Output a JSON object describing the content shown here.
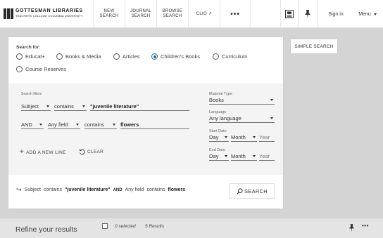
{
  "header": {
    "logo_line1": "GOTTESMAN LIBRARIES",
    "logo_line2": "TEACHERS COLLEGE COLUMBIA UNIVERSITY",
    "nav": [
      {
        "label": "NEW\nSEARCH"
      },
      {
        "label": "JOURNAL\nSEARCH"
      },
      {
        "label": "BROWSE\nSEARCH"
      },
      {
        "label": "CLIO ↗"
      }
    ],
    "more_label": "•••",
    "sign_in": "Sign in",
    "menu": "Menu"
  },
  "search": {
    "for_label": "Search for:",
    "options": [
      {
        "label": "Educat+",
        "selected": false
      },
      {
        "label": "Books & Media",
        "selected": false
      },
      {
        "label": "Articles",
        "selected": false
      },
      {
        "label": "Children's Books",
        "selected": true
      },
      {
        "label": "Curriculum",
        "selected": false
      },
      {
        "label": "Course Reserves",
        "selected": false
      }
    ],
    "filters_label": "Search filters",
    "row1": {
      "field": "Subject",
      "operator": "contains",
      "value": "\"juvenile literature\""
    },
    "row2": {
      "boolean": "AND",
      "field": "Any field",
      "operator": "contains",
      "value": "flowers"
    },
    "add_line": "ADD A NEW LINE",
    "clear": "CLEAR",
    "material_type": {
      "label": "Material Type",
      "value": "Books"
    },
    "language": {
      "label": "Language",
      "value": "Any language"
    },
    "start_date": {
      "label": "Start Date",
      "day": "Day",
      "month": "Month",
      "year": "Year"
    },
    "end_date": {
      "label": "End Date",
      "day": "Day",
      "month": "Month",
      "year": "Year"
    },
    "summary": {
      "field1": "Subject",
      "op1": "contains",
      "val1": "\"juvenile literature\"",
      "bool": "AND",
      "field2": "Any field",
      "op2": "contains",
      "val2": "flowers"
    },
    "search_button": "SEARCH",
    "simple_search": "SIMPLE SEARCH"
  },
  "bottom": {
    "refine": "Refine your results",
    "selected": "0 selected",
    "results": "5 Results",
    "more_label": "•••"
  },
  "colors": {
    "accent": "#2f6e9c",
    "background": "#d4d4d4"
  }
}
